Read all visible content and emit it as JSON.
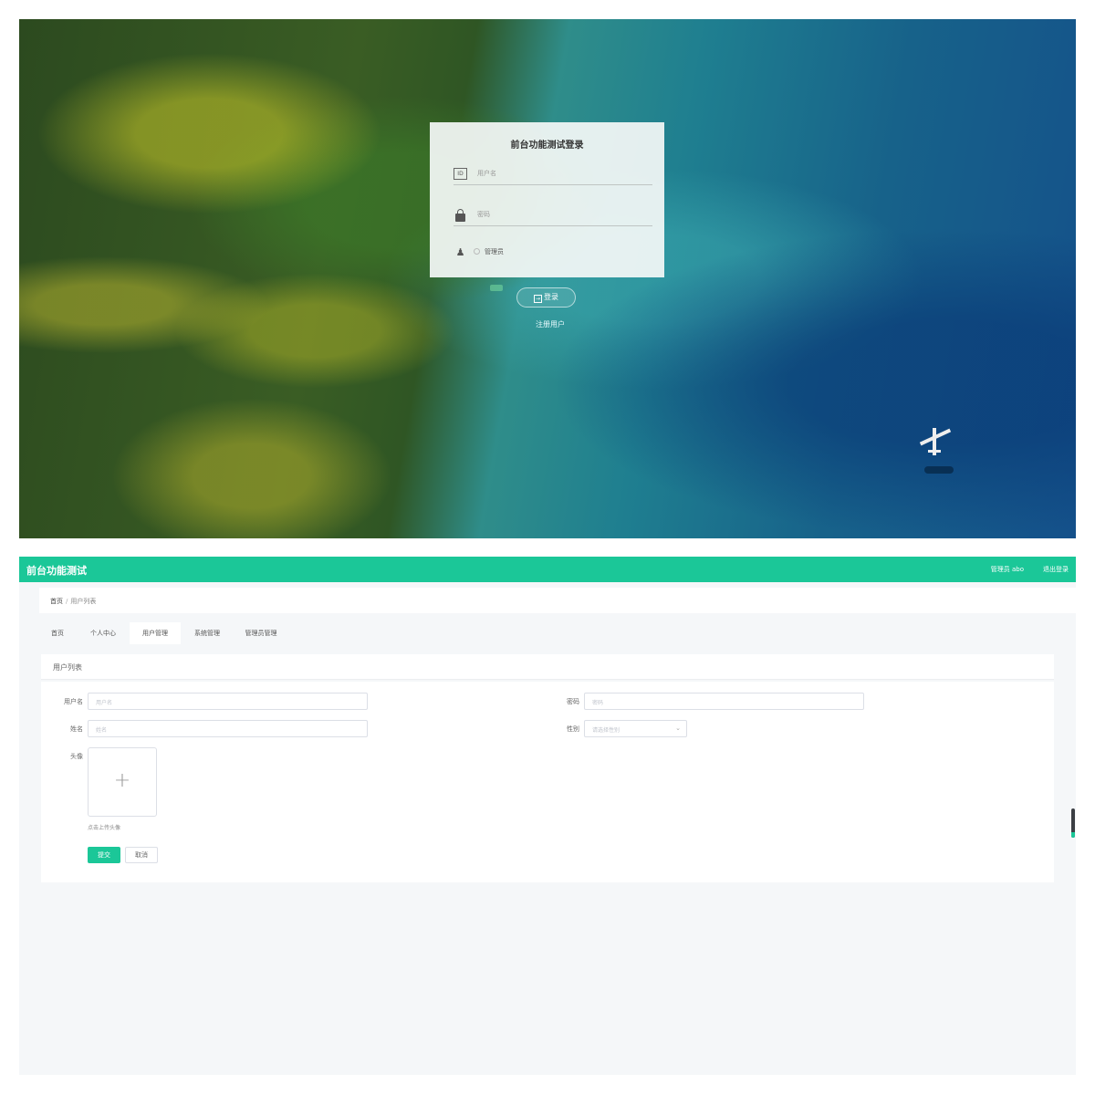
{
  "login": {
    "title": "前台功能测试登录",
    "username_placeholder": "用户名",
    "password_placeholder": "密码",
    "role_label": "管理员",
    "login_button": "登录",
    "register_link": "注册用户",
    "icons": [
      "id-card-icon",
      "lock-icon",
      "user-role-icon",
      "login-icon"
    ]
  },
  "admin": {
    "app_title": "前台功能测试",
    "user_label": "管理员 abo",
    "logout_label": "退出登录",
    "breadcrumb": {
      "home": "首页",
      "separator": "/",
      "current": "用户列表"
    },
    "tabs": [
      {
        "label": "首页"
      },
      {
        "label": "个人中心"
      },
      {
        "label": "用户管理",
        "active": true
      },
      {
        "label": "系统管理"
      },
      {
        "label": "管理员管理"
      }
    ],
    "section_title": "用户列表",
    "form": {
      "username": {
        "label": "用户名",
        "placeholder": "用户名"
      },
      "password": {
        "label": "密码",
        "placeholder": "密码"
      },
      "name": {
        "label": "姓名",
        "placeholder": "姓名"
      },
      "gender": {
        "label": "性别",
        "placeholder": "请选择性别"
      },
      "avatar": {
        "label": "头像",
        "tip": "点击上传头像"
      },
      "submit": "提交",
      "cancel": "取消"
    },
    "accent_color": "#1bc798"
  }
}
